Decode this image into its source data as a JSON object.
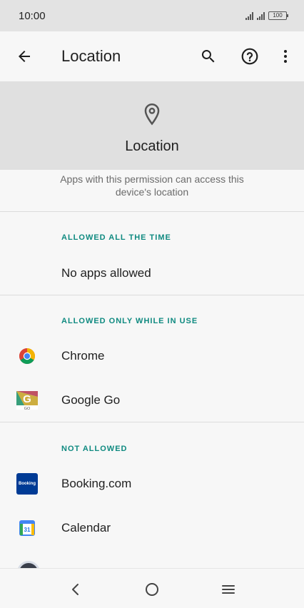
{
  "status_bar": {
    "time": "10:00",
    "battery": "100"
  },
  "app_bar": {
    "title": "Location"
  },
  "hero": {
    "title": "Location"
  },
  "description": "Apps with this permission can access this device's location",
  "sections": {
    "allowed_all_time": {
      "header": "ALLOWED ALL THE TIME",
      "empty_text": "No apps allowed"
    },
    "allowed_in_use": {
      "header": "ALLOWED ONLY WHILE IN USE",
      "apps": [
        "Chrome",
        "Google Go"
      ]
    },
    "not_allowed": {
      "header": "NOT ALLOWED",
      "apps": [
        "Booking.com",
        "Calendar"
      ]
    }
  },
  "icons": {
    "booking_icon_text": "Booking",
    "calendar_icon_text": "31",
    "google_go_icon_text": "GO"
  },
  "colors": {
    "accent": "#0f8a80",
    "hero_bg": "#e0e0e0",
    "booking_blue": "#003b95"
  }
}
